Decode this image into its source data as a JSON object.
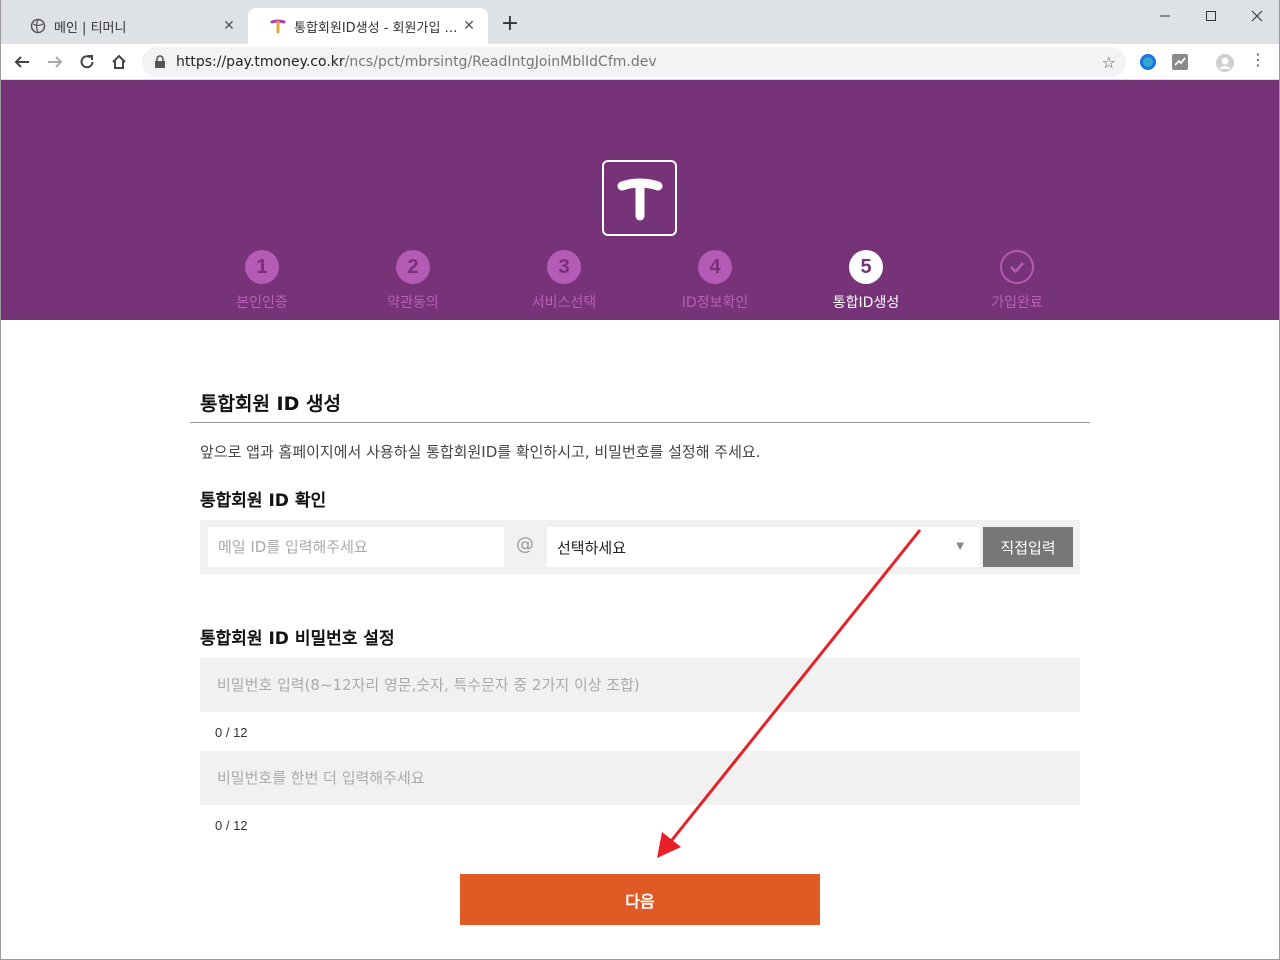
{
  "browser": {
    "tabs": [
      {
        "title": "메인 | 티머니"
      },
      {
        "title": "통합회원ID생성 - 회원가입 - 티머니"
      }
    ],
    "url_host": "https://pay.tmoney.co.kr",
    "url_path": "/ncs/pct/mbrsintg/ReadIntgJoinMblIdCfm.dev"
  },
  "steps": [
    {
      "number": "1",
      "label": "본인인증"
    },
    {
      "number": "2",
      "label": "약관동의"
    },
    {
      "number": "3",
      "label": "서비스선택"
    },
    {
      "number": "4",
      "label": "ID정보확인"
    },
    {
      "number": "5",
      "label": "통합ID생성"
    },
    {
      "number": "✓",
      "label": "가입완료"
    }
  ],
  "current_step": 5,
  "page": {
    "title": "통합회원 ID 생성",
    "description": "앞으로 앱과 홈페이지에서 사용하실 통합회원ID를 확인하시고, 비밀번호를 설정해 주세요.",
    "id_section_title": "통합회원 ID 확인",
    "email_placeholder": "메일 ID를 입력해주세요",
    "at_sign": "@",
    "domain_value": "선택하세요",
    "direct_input_label": "직접입력",
    "pw_section_title": "통합회원 ID 비밀번호 설정",
    "pw_placeholder": "비밀번호 입력(8~12자리 영문,숫자, 특수문자 중 2가지 이상 조합)",
    "pw_count": "0 / 12",
    "pw_confirm_placeholder": "비밀번호를 한번 더 입력해주세요",
    "pw_confirm_count": "0 / 12",
    "next_label": "다음"
  },
  "colors": {
    "header_purple": "#773378",
    "step_pink": "#b45bb5",
    "next_orange": "#e05a26",
    "arrow_red": "#e8202a"
  }
}
